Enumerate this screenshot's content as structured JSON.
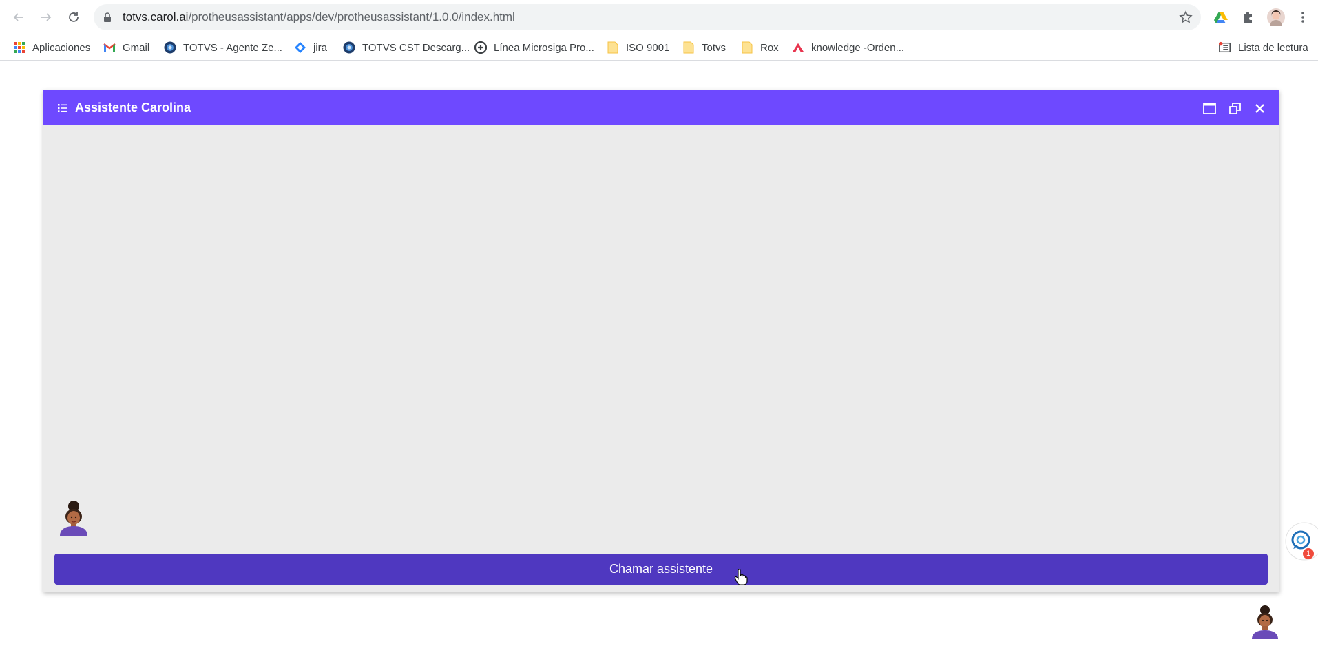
{
  "browser": {
    "url_host": "totvs.carol.ai",
    "url_path": "/protheusassistant/apps/dev/protheusassistant/1.0.0/index.html"
  },
  "bookmarks": [
    {
      "label": "Aplicaciones",
      "icon": "apps-grid-icon"
    },
    {
      "label": "Gmail",
      "icon": "gmail-icon"
    },
    {
      "label": "TOTVS - Agente Ze...",
      "icon": "globe-icon"
    },
    {
      "label": "jira",
      "icon": "jira-icon"
    },
    {
      "label": "TOTVS CST Descarg...",
      "icon": "globe-icon"
    },
    {
      "label": "Línea Microsiga Pro...",
      "icon": "microsiga-icon"
    },
    {
      "label": "ISO 9001",
      "icon": "folder-icon"
    },
    {
      "label": "Totvs",
      "icon": "folder-icon"
    },
    {
      "label": "Rox",
      "icon": "folder-icon"
    },
    {
      "label": "knowledge -Orden...",
      "icon": "knowledge-icon"
    }
  ],
  "reading_list": {
    "label": "Lista de lectura",
    "icon": "reading-list-icon"
  },
  "assistant": {
    "title": "Assistente Carolina",
    "call_button": "Chamar assistente"
  },
  "chat_badge": "1",
  "colors": {
    "header": "#6e49ff",
    "button": "#4f38c0",
    "panel_bg": "#ebebeb"
  }
}
